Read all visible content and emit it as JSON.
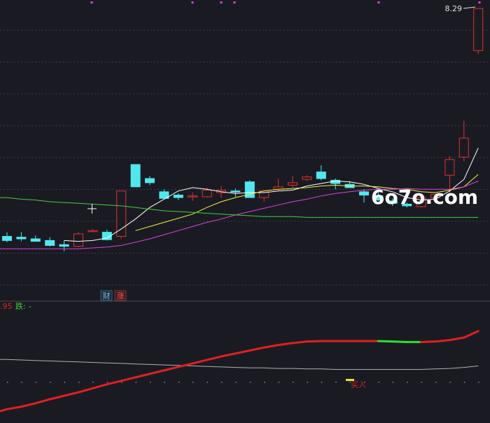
{
  "chart_data": [
    {
      "type": "candlestick",
      "price_range": [
        5.0,
        8.35
      ],
      "last_high_label": "8.29",
      "candles": [
        {
          "o": 5.53,
          "h": 5.58,
          "l": 5.46,
          "c": 5.48
        },
        {
          "o": 5.52,
          "h": 5.58,
          "l": 5.47,
          "c": 5.5
        },
        {
          "o": 5.5,
          "h": 5.54,
          "l": 5.47,
          "c": 5.47
        },
        {
          "o": 5.48,
          "h": 5.52,
          "l": 5.41,
          "c": 5.42
        },
        {
          "o": 5.43,
          "h": 5.48,
          "l": 5.35,
          "c": 5.41
        },
        {
          "o": 5.41,
          "h": 5.58,
          "l": 5.4,
          "c": 5.56
        },
        {
          "o": 5.6,
          "h": 5.62,
          "l": 5.58,
          "c": 5.6
        },
        {
          "o": 5.58,
          "h": 5.61,
          "l": 5.48,
          "c": 5.49
        },
        {
          "o": 5.53,
          "h": 6.08,
          "l": 5.5,
          "c": 6.08
        },
        {
          "o": 6.4,
          "h": 6.4,
          "l": 6.13,
          "c": 6.13
        },
        {
          "o": 6.23,
          "h": 6.26,
          "l": 6.15,
          "c": 6.18
        },
        {
          "o": 6.07,
          "h": 6.1,
          "l": 5.98,
          "c": 5.99
        },
        {
          "o": 6.03,
          "h": 6.05,
          "l": 5.97,
          "c": 6.0
        },
        {
          "o": 6.01,
          "h": 6.06,
          "l": 5.96,
          "c": 6.02
        },
        {
          "o": 6.01,
          "h": 6.12,
          "l": 6.0,
          "c": 6.09
        },
        {
          "o": 6.06,
          "h": 6.14,
          "l": 6.0,
          "c": 6.09
        },
        {
          "o": 6.08,
          "h": 6.11,
          "l": 6.01,
          "c": 6.07
        },
        {
          "o": 6.19,
          "h": 6.21,
          "l": 6.0,
          "c": 6.0
        },
        {
          "o": 6.0,
          "h": 6.09,
          "l": 5.95,
          "c": 6.08
        },
        {
          "o": 6.1,
          "h": 6.23,
          "l": 6.08,
          "c": 6.13
        },
        {
          "o": 6.15,
          "h": 6.26,
          "l": 6.12,
          "c": 6.18
        },
        {
          "o": 6.22,
          "h": 6.27,
          "l": 6.2,
          "c": 6.25
        },
        {
          "o": 6.31,
          "h": 6.39,
          "l": 6.21,
          "c": 6.23
        },
        {
          "o": 6.21,
          "h": 6.23,
          "l": 6.1,
          "c": 6.17
        },
        {
          "o": 6.16,
          "h": 6.2,
          "l": 6.12,
          "c": 6.12
        },
        {
          "o": 6.07,
          "h": 6.1,
          "l": 5.94,
          "c": 6.03
        },
        {
          "o": 6.02,
          "h": 6.08,
          "l": 5.96,
          "c": 5.97
        },
        {
          "o": 5.96,
          "h": 5.99,
          "l": 5.9,
          "c": 5.93
        },
        {
          "o": 5.92,
          "h": 5.94,
          "l": 5.88,
          "c": 5.9
        },
        {
          "o": 5.89,
          "h": 6.0,
          "l": 5.88,
          "c": 6.0
        },
        {
          "o": 6.0,
          "h": 6.04,
          "l": 5.99,
          "c": 6.04
        },
        {
          "o": 6.27,
          "h": 6.5,
          "l": 6.03,
          "c": 6.46
        },
        {
          "o": 6.49,
          "h": 6.93,
          "l": 6.44,
          "c": 6.72
        },
        {
          "o": 7.78,
          "h": 8.29,
          "l": 7.74,
          "c": 8.29
        }
      ],
      "ma": [
        {
          "name": "MA5",
          "color": "#ffffff",
          "values": [
            null,
            null,
            null,
            null,
            5.48,
            5.47,
            5.48,
            5.51,
            5.62,
            5.74,
            5.88,
            5.98,
            6.08,
            6.12,
            6.1,
            6.07,
            6.05,
            6.06,
            6.06,
            6.08,
            6.09,
            6.14,
            6.17,
            6.2,
            6.19,
            6.16,
            6.11,
            6.07,
            6.0,
            5.97,
            5.98,
            6.08,
            6.22,
            6.6
          ]
        },
        {
          "name": "MA10",
          "color": "#f0f040",
          "values": [
            null,
            null,
            null,
            null,
            null,
            null,
            null,
            null,
            null,
            5.6,
            5.65,
            5.7,
            5.75,
            5.8,
            5.88,
            5.95,
            6.0,
            6.04,
            6.08,
            6.1,
            6.11,
            6.12,
            6.14,
            6.15,
            6.14,
            6.14,
            6.13,
            6.11,
            6.1,
            6.07,
            6.06,
            6.09,
            6.13,
            6.28
          ]
        },
        {
          "name": "MA20",
          "color": "#e040e0",
          "values": [
            5.38,
            5.38,
            5.38,
            5.38,
            5.38,
            5.38,
            5.39,
            5.4,
            5.42,
            5.46,
            5.5,
            5.55,
            5.6,
            5.65,
            5.7,
            5.74,
            5.79,
            5.83,
            5.87,
            5.91,
            5.95,
            5.98,
            6.02,
            6.05,
            6.07,
            6.09,
            6.1,
            6.1,
            6.11,
            6.1,
            6.1,
            6.1,
            6.13,
            6.2
          ]
        },
        {
          "name": "MA60",
          "color": "#40d040",
          "values": [
            6.0,
            5.98,
            5.97,
            5.95,
            5.94,
            5.93,
            5.92,
            5.91,
            5.9,
            5.88,
            5.86,
            5.84,
            5.83,
            5.82,
            5.81,
            5.8,
            5.79,
            5.78,
            5.77,
            5.77,
            5.77,
            5.76,
            5.76,
            5.76,
            5.76,
            5.76,
            5.76,
            5.76,
            5.76,
            5.76,
            5.76,
            5.76,
            5.76,
            5.76
          ]
        }
      ],
      "markers": {
        "cai": "财",
        "zhang": "涨"
      },
      "watermark": "6o7o.com"
    },
    {
      "type": "line",
      "legend_value_fragment": ".95",
      "legend_die_label": "跌:",
      "legend_die_value": "-",
      "buy_label": "买入",
      "series": [
        {
          "name": "",
          "color": "#e02020",
          "values": [
            0.58,
            0.63,
            0.7,
            0.78,
            0.85,
            0.92,
            1.0,
            1.08,
            1.15,
            1.22,
            1.29,
            1.36,
            1.43,
            1.5,
            1.57,
            1.64,
            1.7,
            1.76,
            1.82,
            1.87,
            1.91,
            1.94,
            1.95,
            1.95,
            1.95,
            1.95,
            1.95,
            1.94,
            1.93,
            1.93,
            1.94,
            1.97,
            2.02,
            2.15
          ]
        },
        {
          "name": "",
          "color": "#b0b0b0",
          "values": [
            1.58,
            1.57,
            1.56,
            1.55,
            1.54,
            1.53,
            1.52,
            1.51,
            1.5,
            1.49,
            1.48,
            1.47,
            1.46,
            1.45,
            1.44,
            1.43,
            1.42,
            1.41,
            1.41,
            1.4,
            1.4,
            1.39,
            1.39,
            1.38,
            1.38,
            1.38,
            1.38,
            1.38,
            1.38,
            1.38,
            1.39,
            1.4,
            1.42,
            1.45
          ]
        }
      ],
      "ylim": [
        0.5,
        2.4
      ]
    }
  ]
}
